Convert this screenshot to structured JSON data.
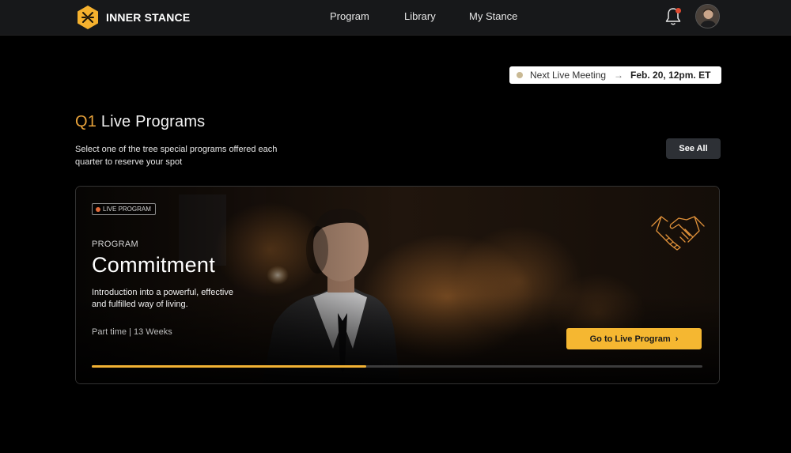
{
  "brand": {
    "name": "INNER STANCE",
    "accent": "#f5b731"
  },
  "nav": {
    "items": [
      {
        "label": "Program"
      },
      {
        "label": "Library"
      },
      {
        "label": "My Stance"
      }
    ]
  },
  "header_icons": {
    "notifications": "bell-icon",
    "profile": "avatar"
  },
  "next_meeting": {
    "label": "Next Live Meeting",
    "date": "Feb. 20, 12pm. ET"
  },
  "section": {
    "title_prefix": "Q1",
    "title": " Live Programs",
    "subtitle": "Select one of the tree special programs offered each quarter to reserve your spot",
    "see_all_label": "See All"
  },
  "program_card": {
    "badge": "LIVE PROGRAM",
    "eyebrow": "PROGRAM",
    "title": "Commitment",
    "description": "Introduction into a powerful, effective and fulfilled way of living.",
    "meta": "Part time | 13 Weeks",
    "cta_label": "Go to Live Program",
    "icon": "handshake-icon",
    "progress": 0.45
  }
}
